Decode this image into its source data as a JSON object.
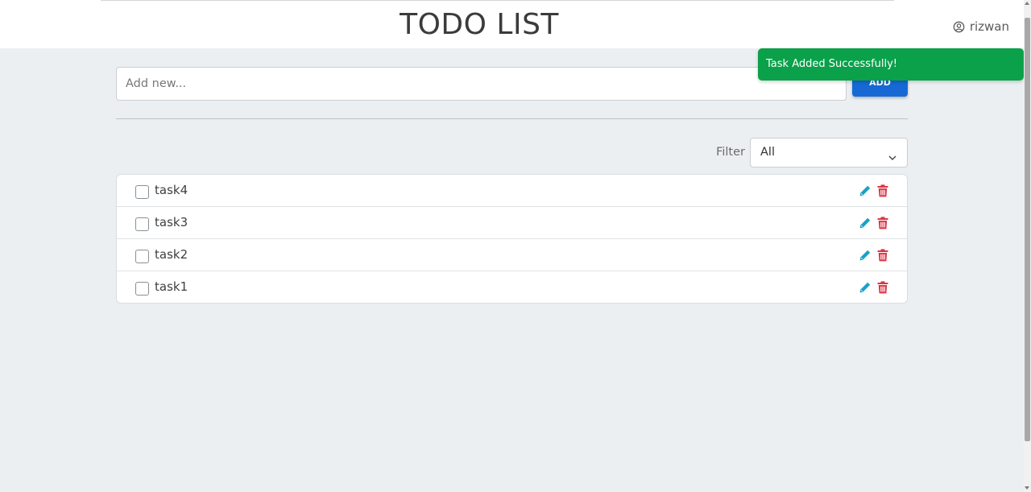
{
  "header": {
    "title": "TODO LIST",
    "username": "rizwan",
    "user_icon": "user-circle-icon"
  },
  "add_form": {
    "placeholder": "Add new...",
    "value": "",
    "button_label": "ADD"
  },
  "filter": {
    "label": "Filter",
    "selected": "All",
    "icon": "chevron-down-icon"
  },
  "tasks": [
    {
      "label": "task4",
      "checked": false
    },
    {
      "label": "task3",
      "checked": false
    },
    {
      "label": "task2",
      "checked": false
    },
    {
      "label": "task1",
      "checked": false
    }
  ],
  "toast": {
    "message": "Task Added Successfully!",
    "color": "#0aa14a"
  },
  "colors": {
    "accent": "#1669d4",
    "edit": "#17a2c8",
    "delete": "#dc3545",
    "background": "#eceff1"
  },
  "icons": {
    "edit": "pencil-icon",
    "delete": "trash-icon"
  }
}
